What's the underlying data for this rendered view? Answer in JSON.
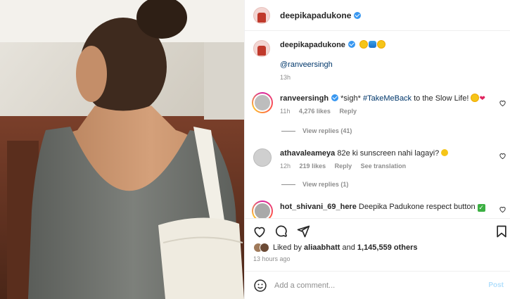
{
  "post": {
    "author": "deepikapadukone",
    "caption_mention": "@ranveersingh",
    "caption_time": "13h",
    "likes_liked_by_prefix": "Liked by",
    "likes_liked_by_user": "aliaabhatt",
    "likes_and": "and",
    "likes_count": "1,145,559 others",
    "time_ago": "13 hours ago"
  },
  "comments": [
    {
      "user": "ranveersingh",
      "text_before": "*sigh*",
      "hashtag": "#TakeMeBack",
      "text_after": "to the Slow Life!",
      "time": "11h",
      "likes": "4,276 likes",
      "reply": "Reply",
      "view_replies": "View replies (41)"
    },
    {
      "user": "athavaleameya",
      "text": "82e ki sunscreen nahi lagayi?",
      "time": "12h",
      "likes": "219 likes",
      "reply": "Reply",
      "translate": "See translation",
      "view_replies": "View replies (1)"
    },
    {
      "user": "hot_shivani_69_here",
      "text": "Deepika Padukone respect button"
    }
  ],
  "composer": {
    "placeholder": "Add a comment...",
    "post_label": "Post"
  },
  "icons": {
    "like": "heart-icon",
    "comment": "comment-icon",
    "share": "share-icon",
    "save": "bookmark-icon",
    "emoji": "emoji-icon"
  }
}
